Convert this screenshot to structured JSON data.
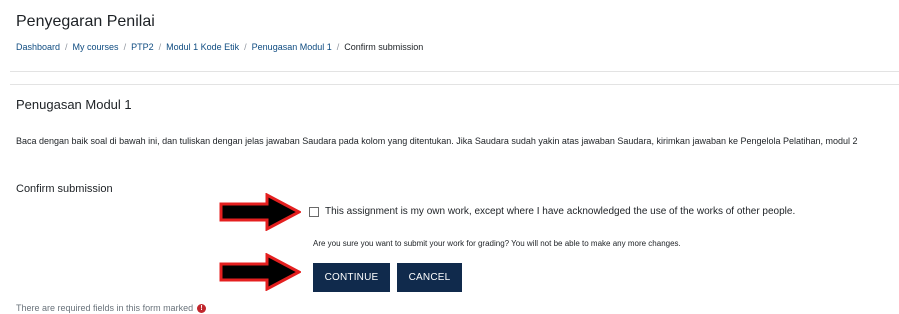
{
  "page": {
    "title": "Penyegaran Penilai",
    "breadcrumb": [
      {
        "label": "Dashboard"
      },
      {
        "label": "My courses"
      },
      {
        "label": "PTP2"
      },
      {
        "label": "Modul 1 Kode Etik"
      },
      {
        "label": "Penugasan Modul 1"
      },
      {
        "label": "Confirm submission"
      }
    ],
    "separator": "/"
  },
  "assignment": {
    "title": "Penugasan Modul 1",
    "instructions": "Baca dengan baik soal di bawah ini, dan tuliskan dengan jelas jawaban Saudara pada kolom yang ditentukan. Jika Saudara sudah yakin atas jawaban Saudara, kirimkan jawaban ke Pengelola Pelatihan, modul 2"
  },
  "confirm": {
    "heading": "Confirm submission",
    "checkbox_label": "This assignment is my own work, except where I have acknowledged the use of the works of other people.",
    "checkbox_checked": false,
    "question": "Are you sure you want to submit your work for grading? You will not be able to make any more changes.",
    "continue_label": "CONTINUE",
    "cancel_label": "CANCEL"
  },
  "footer": {
    "required_note": "There are required fields in this form marked",
    "required_icon": "exclamation-circle-icon"
  },
  "colors": {
    "button_bg": "#102a4c",
    "link": "#0f4c81",
    "arrow_fill": "#000000",
    "arrow_outline": "#e41f1f",
    "required": "#c1272d"
  }
}
